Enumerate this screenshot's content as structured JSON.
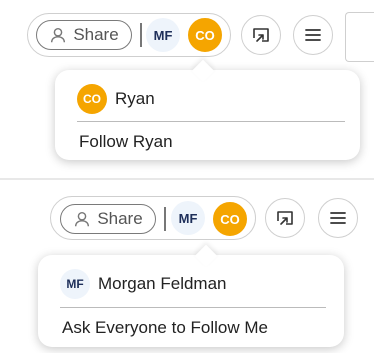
{
  "toolbar": {
    "share_label": "Share",
    "avatar_mf_initials": "MF",
    "avatar_co_initials": "CO"
  },
  "panel_a": {
    "popover_user_initials": "CO",
    "popover_user_name": "Ryan",
    "popover_action": "Follow Ryan"
  },
  "panel_b": {
    "popover_user_initials": "MF",
    "popover_user_name": "Morgan Feldman",
    "popover_action": "Ask Everyone to Follow Me"
  },
  "colors": {
    "co_avatar": "#f5a500",
    "mf_avatar_bg": "#eef4fb",
    "mf_avatar_text": "#1e2f5a"
  },
  "icons": [
    "user-share-icon",
    "cast-icon",
    "hamburger-menu-icon"
  ]
}
